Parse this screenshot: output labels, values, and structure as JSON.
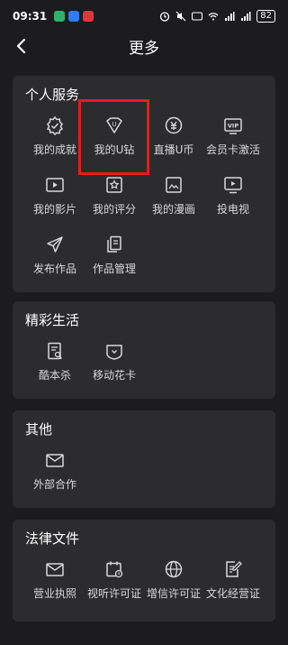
{
  "status": {
    "time": "09:31",
    "battery": "82"
  },
  "header": {
    "title": "更多"
  },
  "sections": {
    "personal": {
      "title": "个人服务",
      "items": [
        {
          "label": "我的成就",
          "icon": "achievement-icon"
        },
        {
          "label": "我的U钻",
          "icon": "diamond-icon"
        },
        {
          "label": "直播U币",
          "icon": "coin-icon"
        },
        {
          "label": "会员卡激活",
          "icon": "vip-card-icon"
        },
        {
          "label": "我的影片",
          "icon": "video-icon"
        },
        {
          "label": "我的评分",
          "icon": "rating-icon"
        },
        {
          "label": "我的漫画",
          "icon": "comic-icon"
        },
        {
          "label": "投电视",
          "icon": "tv-cast-icon"
        },
        {
          "label": "发布作品",
          "icon": "send-icon"
        },
        {
          "label": "作品管理",
          "icon": "works-icon"
        }
      ]
    },
    "life": {
      "title": "精彩生活",
      "items": [
        {
          "label": "酷本杀",
          "icon": "script-icon"
        },
        {
          "label": "移动花卡",
          "icon": "sim-card-icon"
        }
      ]
    },
    "other": {
      "title": "其他",
      "items": [
        {
          "label": "外部合作",
          "icon": "mail-icon"
        }
      ]
    },
    "legal": {
      "title": "法律文件",
      "items": [
        {
          "label": "营业执照",
          "icon": "mail-icon"
        },
        {
          "label": "视听许可证",
          "icon": "calendar-icon"
        },
        {
          "label": "增信许可证",
          "icon": "globe-icon"
        },
        {
          "label": "文化经营证",
          "icon": "edit-doc-icon"
        }
      ]
    }
  },
  "colors": {
    "background": "#1c1c1e",
    "card": "#2c2c2e",
    "highlight": "#e41d1d"
  }
}
